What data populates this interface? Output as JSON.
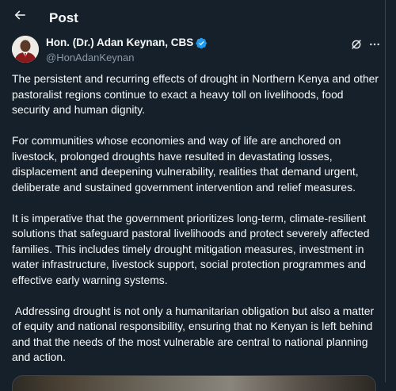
{
  "header": {
    "title": "Post",
    "back_icon": "arrow-left-icon"
  },
  "author": {
    "display_name": "Hon. (Dr.) Adan Keynan, CBS",
    "handle": "@HonAdanKeynan",
    "verified_color": "#1d9bf0"
  },
  "actions": {
    "grok_icon": "grok-icon",
    "more_icon": "more-horizontal-icon"
  },
  "tweet": {
    "paragraphs": [
      "The persistent and recurring effects of drought in Northern Kenya and other pastoralist regions continue to exact a heavy toll on livelihoods, food security and human dignity.",
      "For communities whose economies and way of life are anchored on livestock, prolonged droughts have resulted in devastating losses, displacement and deepening vulnerability, realities that demand urgent, deliberate and sustained government intervention and relief measures.",
      "It is imperative that the government prioritizes long-term, climate-resilient solutions that safeguard pastoral livelihoods and protect severely affected families. This includes timely drought mitigation measures, investment in water infrastructure, livestock support, social protection programmes and effective early warning systems.",
      " Addressing drought is not only a humanitarian obligation but also a matter of equity and national responsibility, ensuring that no Kenyan is left behind and that the needs of the most vulnerable are central to national planning and action."
    ]
  },
  "theme": {
    "background": "#15202b",
    "text": "#f7f9f9",
    "secondary_text": "#8b98a5",
    "accent": "#1d9bf0"
  }
}
